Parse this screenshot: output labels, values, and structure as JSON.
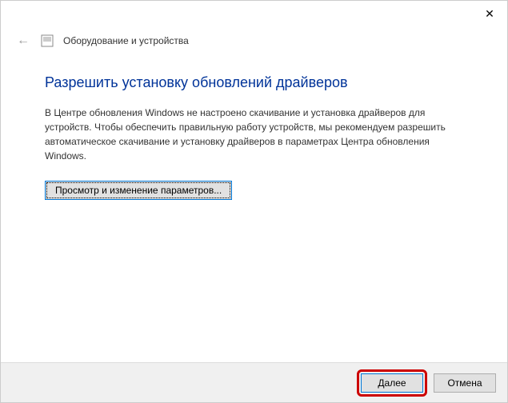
{
  "titlebar": {
    "close_label": "✕"
  },
  "header": {
    "back_glyph": "←",
    "title": "Оборудование и устройства"
  },
  "content": {
    "heading": "Разрешить установку обновлений драйверов",
    "description": "В Центре обновления Windows не настроено скачивание и установка драйверов для устройств. Чтобы обеспечить правильную работу устройств, мы рекомендуем разрешить автоматическое скачивание и установку драйверов в параметрах Центра обновления Windows.",
    "settings_button": "Просмотр и изменение параметров..."
  },
  "footer": {
    "next": "Далее",
    "cancel": "Отмена"
  }
}
